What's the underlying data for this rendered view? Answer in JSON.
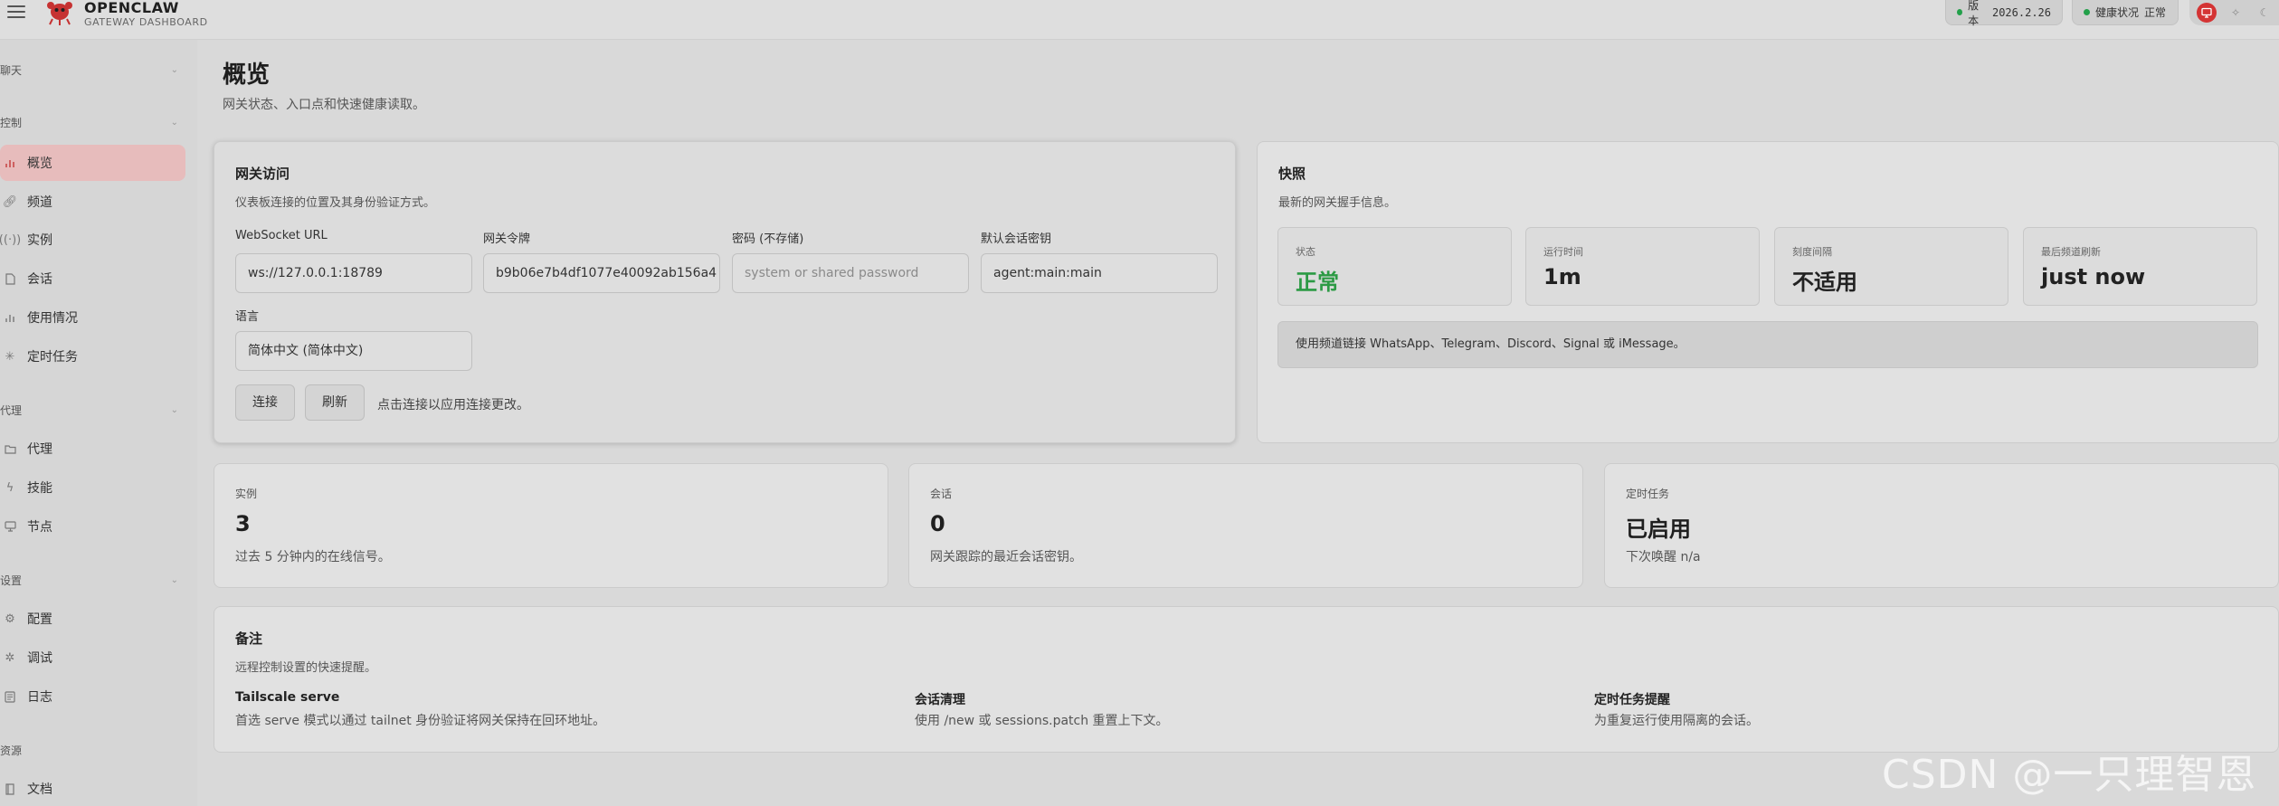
{
  "header": {
    "brand_name": "OPENCLAW",
    "brand_sub": "GATEWAY DASHBOARD",
    "version_label": "版本",
    "version_value": "2026.2.26",
    "health_label": "健康状况",
    "health_value": "正常",
    "status_color": "#23a04a",
    "accent_color": "#d43434"
  },
  "sidebar": {
    "groups": [
      {
        "title": "聊天"
      },
      {
        "title": "控制"
      },
      {
        "title": "代理"
      },
      {
        "title": "设置"
      },
      {
        "title": "资源"
      }
    ],
    "items": [
      {
        "label": "概览",
        "icon": "bar-chart-icon",
        "active": true
      },
      {
        "label": "频道",
        "icon": "link-icon"
      },
      {
        "label": "实例",
        "icon": "radio-icon"
      },
      {
        "label": "会话",
        "icon": "file-icon"
      },
      {
        "label": "使用情况",
        "icon": "bar-chart-icon"
      },
      {
        "label": "定时任务",
        "icon": "loader-icon"
      },
      {
        "label": "代理",
        "icon": "folder-icon"
      },
      {
        "label": "技能",
        "icon": "zap-icon"
      },
      {
        "label": "节点",
        "icon": "monitor-icon"
      },
      {
        "label": "配置",
        "icon": "settings-icon"
      },
      {
        "label": "调试",
        "icon": "bug-icon"
      },
      {
        "label": "日志",
        "icon": "log-icon"
      },
      {
        "label": "文档",
        "icon": "book-icon"
      }
    ]
  },
  "page": {
    "title": "概览",
    "subtitle": "网关状态、入口点和快速健康读取。"
  },
  "gateway": {
    "title": "网关访问",
    "subtitle": "仪表板连接的位置及其身份验证方式。",
    "ws_label": "WebSocket URL",
    "ws_value": "ws://127.0.0.1:18789",
    "token_label": "网关令牌",
    "token_value": "b9b06e7b4df1077e40092ab156a4",
    "password_label": "密码 (不存储)",
    "password_placeholder": "system or shared password",
    "session_key_label": "默认会话密钥",
    "session_key_value": "agent:main:main",
    "language_label": "语言",
    "language_value": "简体中文 (简体中文)",
    "connect_label": "连接",
    "refresh_label": "刷新",
    "hint": "点击连接以应用连接更改。"
  },
  "snapshot": {
    "title": "快照",
    "subtitle": "最新的网关握手信息。",
    "stats": [
      {
        "label": "状态",
        "value": "正常"
      },
      {
        "label": "运行时间",
        "value": "1m"
      },
      {
        "label": "刻度间隔",
        "value": "不适用"
      },
      {
        "label": "最后频道刷新",
        "value": "just now"
      }
    ],
    "info": "使用频道链接 WhatsApp、Telegram、Discord、Signal 或 iMessage。"
  },
  "metrics": [
    {
      "label": "实例",
      "value": "3",
      "note": "过去 5 分钟内的在线信号。"
    },
    {
      "label": "会话",
      "value": "0",
      "note": "网关跟踪的最近会话密钥。"
    },
    {
      "label": "定时任务",
      "value": "已启用",
      "note": "下次唤醒 n/a"
    }
  ],
  "notes": {
    "title": "备注",
    "subtitle": "远程控制设置的快速提醒。",
    "items": [
      {
        "title": "Tailscale serve",
        "text": "首选 serve 模式以通过 tailnet 身份验证将网关保持在回环地址。"
      },
      {
        "title": "会话清理",
        "text": "使用 /new 或 sessions.patch 重置上下文。"
      },
      {
        "title": "定时任务提醒",
        "text": "为重复运行使用隔离的会话。"
      }
    ]
  },
  "watermark": "CSDN @一只理智恩"
}
